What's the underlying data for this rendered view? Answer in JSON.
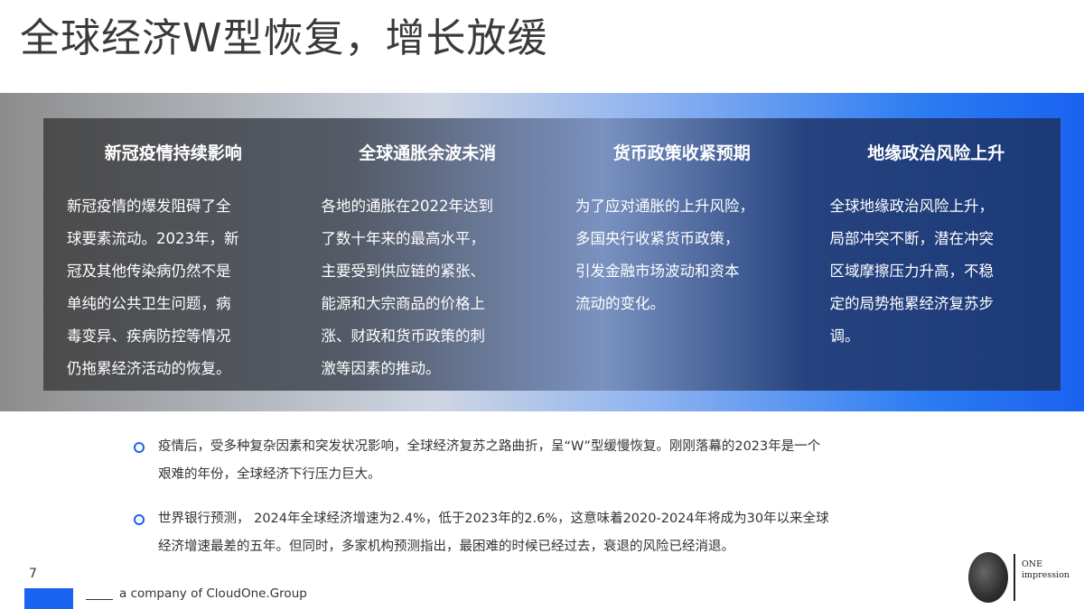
{
  "title": "全球经济W型恢复，增长放缓",
  "columns": [
    {
      "heading": "新冠疫情持续影响",
      "lines": [
        "新冠疫情的爆发阻碍了全",
        "球要素流动。2023年，新",
        "冠及其他传染病仍然不是",
        "单纯的公共卫生问题，病",
        "毒变异、疾病防控等情况",
        "仍拖累经济活动的恢复。"
      ]
    },
    {
      "heading": "全球通胀余波未消",
      "lines": [
        "各地的通胀在2022年达到",
        "了数十年来的最高水平，",
        "主要受到供应链的紧张、",
        "能源和大宗商品的价格上",
        "涨、财政和货币政策的刺",
        "激等因素的推动。"
      ]
    },
    {
      "heading": "货币政策收紧预期",
      "lines": [
        "为了应对通胀的上升风险，",
        "多国央行收紧货币政策，",
        "引发金融市场波动和资本",
        "流动的变化。"
      ]
    },
    {
      "heading": "地缘政治风险上升",
      "lines": [
        "全球地缘政治风险上升，",
        "局部冲突不断，潜在冲突",
        "区域摩擦压力升高，不稳",
        "定的局势拖累经济复苏步",
        "调。"
      ]
    }
  ],
  "bullets": [
    {
      "lines": [
        "疫情后，受多种复杂因素和突发状况影响，全球经济复苏之路曲折，呈“W”型缓慢恢复。刚刚落幕的2023年是一个",
        "艰难的年份，全球经济下行压力巨大。"
      ]
    },
    {
      "lines": [
        "世界银行预测， 2024年全球经济增速为2.4%，低于2023年的2.6%，这意味着2020-2024年将成为30年以来全球",
        "经济增速最差的五年。但同时，多家机构预测指出，最困难的时候已经过去，衰退的风险已经消退。"
      ]
    }
  ],
  "footer": {
    "page_number": "7",
    "company": "a company of CloudOne.Group",
    "logo_line1": "ONE",
    "logo_line2": "impression"
  },
  "colors": {
    "accent": "#1a62f0",
    "panel_text": "#ffffff"
  },
  "icons": {
    "bullet": "circle-bullet-icon",
    "logo": "one-impression-logo-icon"
  }
}
